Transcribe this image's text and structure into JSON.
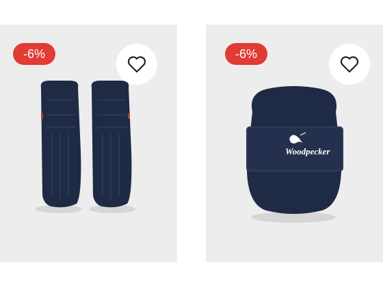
{
  "products": [
    {
      "discount_badge": "-6%",
      "wishlist_icon": "heart-outline-icon",
      "image": "navy batting leg pads"
    },
    {
      "discount_badge": "-6%",
      "wishlist_icon": "heart-outline-icon",
      "image": "navy chest guard",
      "brand_on_product": "Woodpecker"
    }
  ],
  "colors": {
    "card_bg": "#ededed",
    "badge_bg": "#e03b34",
    "product_navy": "#1f2a44"
  }
}
